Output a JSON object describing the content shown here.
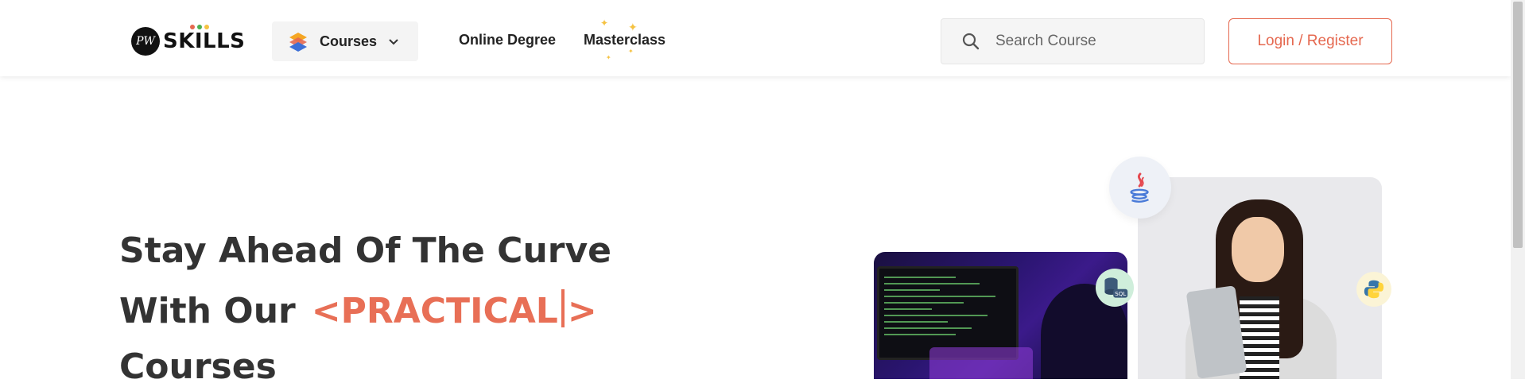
{
  "header": {
    "logo": {
      "badge_text": "PW",
      "text": "SKILLS",
      "dot_colors": [
        "#e5684f",
        "#4caf50",
        "#f5c242"
      ]
    },
    "courses_label": "Courses",
    "nav": {
      "online_degree": "Online Degree",
      "masterclass": "Masterclass"
    },
    "search": {
      "placeholder": "Search Course",
      "value": ""
    },
    "login_label": "Login / Register"
  },
  "hero": {
    "line1": "Stay Ahead Of The Curve",
    "line2_prefix": "With Our",
    "highlight_open": "<PRACTICAL",
    "highlight_close": ">",
    "line3": "Courses"
  },
  "badges": {
    "sql_label": "SQL"
  },
  "colors": {
    "accent": "#e86f56",
    "text": "#333333",
    "search_bg": "#f5f5f5"
  },
  "icons": [
    "pw-skills-logo",
    "layers-icon",
    "chevron-down-icon",
    "search-icon",
    "java-icon",
    "sql-icon",
    "python-icon"
  ]
}
